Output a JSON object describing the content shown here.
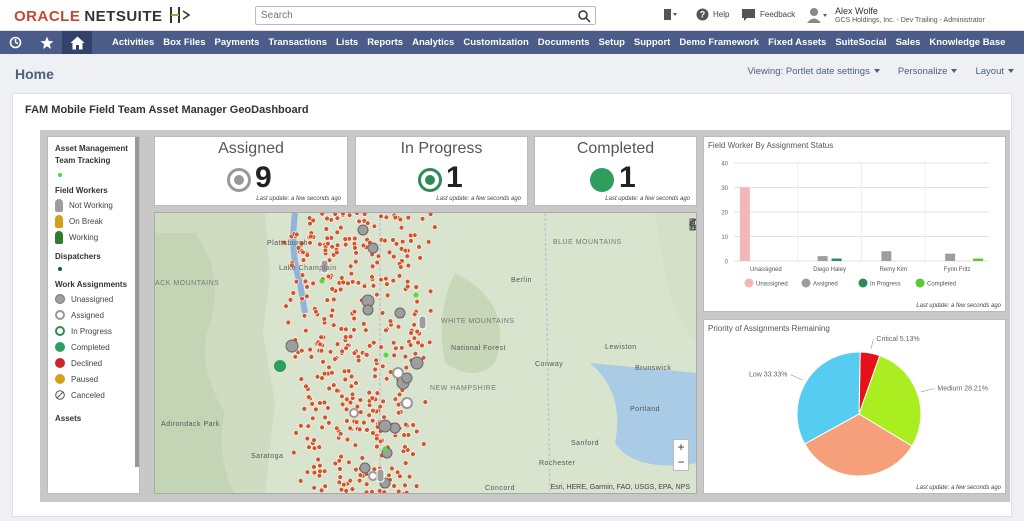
{
  "brand": {
    "oracle": "ORACLE",
    "netsuite": "NETSUITE"
  },
  "search": {
    "placeholder": "Search"
  },
  "header": {
    "help": "Help",
    "feedback": "Feedback",
    "user_name": "Alex Wolfe",
    "user_role": "GCS Holdings, Inc. - Dev Trailing - Administrator"
  },
  "nav": {
    "items": [
      "Activities",
      "Box Files",
      "Payments",
      "Transactions",
      "Lists",
      "Reports",
      "Analytics",
      "Customization",
      "Documents",
      "Setup",
      "Support",
      "Demo Framework",
      "Fixed Assets",
      "SuiteSocial",
      "Sales",
      "Knowledge Base"
    ]
  },
  "page": {
    "title": "Home",
    "viewing": "Viewing: Portlet date settings",
    "personalize": "Personalize",
    "layout": "Layout"
  },
  "portlet": {
    "title": "FAM Mobile Field Team Asset Manager GeoDashboard"
  },
  "legend": {
    "asset_tracking": "Asset Management Team Tracking",
    "field_workers": "Field Workers",
    "fw_items": [
      "Not Working",
      "On Break",
      "Working"
    ],
    "dispatchers": "Dispatchers",
    "work_assignments": "Work Assignments",
    "wa_items": [
      "Unassigned",
      "Assigned",
      "In Progress",
      "Completed",
      "Declined",
      "Paused",
      "Canceled"
    ],
    "assets": "Assets",
    "colors": {
      "unassigned": "#9e9e9e",
      "assigned": "#bdbdbd",
      "in_progress": "#2e8b57",
      "completed": "#2e9e5e",
      "declined": "#c62828",
      "paused": "#d4a017",
      "working": "#2e7d32",
      "on_break": "#d4a017",
      "not_working": "#9e9e9e"
    }
  },
  "stats": {
    "assigned": {
      "label": "Assigned",
      "value": "9"
    },
    "in_progress": {
      "label": "In Progress",
      "value": "1"
    },
    "completed": {
      "label": "Completed",
      "value": "1"
    },
    "update": "Last update: a few seconds ago"
  },
  "map": {
    "labels": [
      "Plattsburgh",
      "Lake Champlain",
      "ACK MOUNTAINS",
      "Adirondack Park",
      "Saratoga",
      "Berlin",
      "WHITE MOUNTAINS",
      "National Forest",
      "BLUE MOUNTAINS",
      "Lewiston",
      "Conway",
      "Brunswick",
      "NEW HAMPSHIRE",
      "Portland",
      "Sanford",
      "Rochester",
      "Concord"
    ],
    "attribution": "Esri, HERE, Garmin, FAO, USGS, EPA, NPS",
    "zoom_in": "+",
    "zoom_out": "−"
  },
  "bar_panel": {
    "title": "Field Worker By Assignment Status",
    "update": "Last update: a few seconds ago"
  },
  "pie_panel": {
    "title": "Priority of Assignments Remaining",
    "update": "Last update: a few seconds ago"
  },
  "chart_data": [
    {
      "type": "bar",
      "title": "Field Worker By Assignment Status",
      "categories": [
        "Unassigned",
        "Diego Haley",
        "Remy Kim",
        "Fynn Fritz"
      ],
      "series": [
        {
          "name": "Unassigned",
          "color": "#f4b6b9",
          "values": [
            30,
            0,
            0,
            0
          ]
        },
        {
          "name": "Assigned",
          "color": "#9e9e9e",
          "values": [
            0,
            2,
            4,
            3
          ]
        },
        {
          "name": "In Progress",
          "color": "#2e8b57",
          "values": [
            0,
            1,
            0,
            0
          ]
        },
        {
          "name": "Completed",
          "color": "#55cc33",
          "values": [
            0,
            0,
            0,
            1
          ]
        }
      ],
      "yticks": [
        "0",
        "10",
        "20",
        "30",
        "40"
      ],
      "ylim": [
        0,
        40
      ],
      "grid": true,
      "legend": "bottom"
    },
    {
      "type": "pie",
      "title": "Priority of Assignments Remaining",
      "slices": [
        {
          "label": "Critical 5.13%",
          "value": 5.13,
          "color": "#e8111a"
        },
        {
          "label": "Medium 28.21%",
          "value": 28.21,
          "color": "#aaee22"
        },
        {
          "label": "",
          "value": 33.33,
          "color": "#f5a07a"
        },
        {
          "label": "Low 33.33%",
          "value": 33.33,
          "color": "#55ccf0"
        }
      ]
    }
  ]
}
